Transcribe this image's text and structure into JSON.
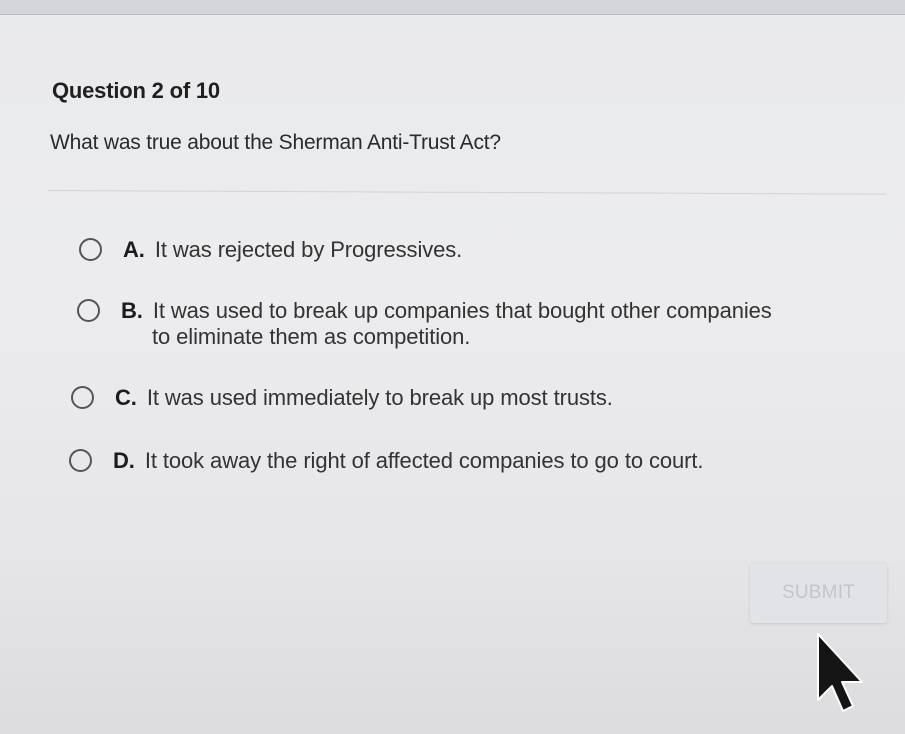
{
  "quiz": {
    "question_number": "Question 2 of 10",
    "question_text": "What was true about the Sherman Anti-Trust Act?",
    "options": [
      {
        "letter": "A.",
        "text": "It was rejected by Progressives."
      },
      {
        "letter": "B.",
        "text_line1": "It was used to break up companies that bought other companies",
        "text_line2": "to eliminate them as competition."
      },
      {
        "letter": "C.",
        "text": "It was used immediately to break up most trusts."
      },
      {
        "letter": "D.",
        "text": "It took away the right of affected companies to go to court."
      }
    ],
    "submit_label": "SUBMIT"
  },
  "icons": {
    "radio": "radio-unselected-icon",
    "cursor": "mouse-pointer-icon"
  },
  "colors": {
    "background": "#ebebed",
    "text": "#2b2b2b",
    "submit_disabled_bg": "#e1e3e7",
    "submit_disabled_text": "#c2c6cc"
  }
}
